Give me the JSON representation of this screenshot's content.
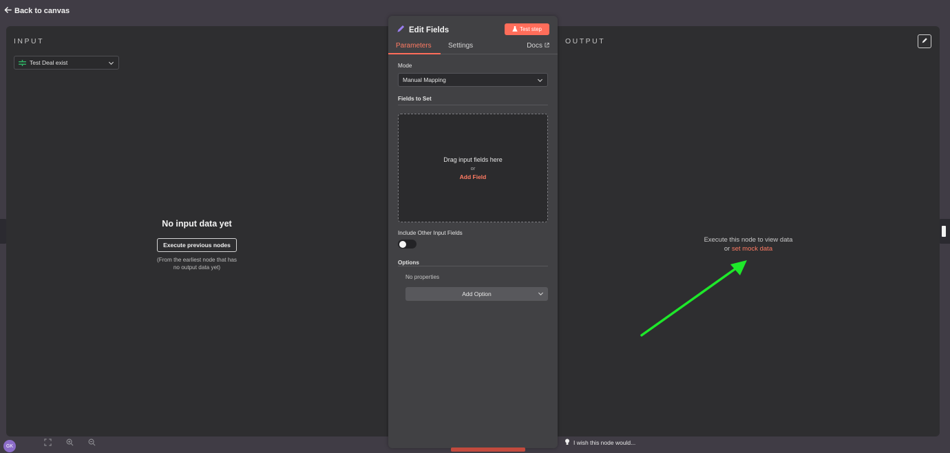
{
  "topbar": {
    "back_label": "Back to canvas"
  },
  "input_panel": {
    "title": "INPUT",
    "selected_node": "Test Deal exist",
    "empty_title": "No input data yet",
    "execute_button": "Execute previous nodes",
    "hint_line1": "(From the earliest node that has",
    "hint_line2": "no output data yet)"
  },
  "output_panel": {
    "title": "OUTPUT",
    "empty_line": "Execute this node to view data",
    "or_label": "or",
    "mock_link": "set mock data"
  },
  "node_panel": {
    "title": "Edit Fields",
    "test_step_label": "Test step",
    "tabs": [
      {
        "label": "Parameters",
        "active": true
      },
      {
        "label": "Settings",
        "active": false
      }
    ],
    "docs_label": "Docs",
    "mode_label": "Mode",
    "mode_value": "Manual Mapping",
    "fields_to_set_label": "Fields to Set",
    "dropzone_text": "Drag input fields here",
    "dropzone_or": "or",
    "add_field_label": "Add Field",
    "include_other_label": "Include Other Input Fields",
    "include_other_enabled": false,
    "options_label": "Options",
    "no_properties": "No properties",
    "add_option_label": "Add Option"
  },
  "footer": {
    "avatar_initials": "GK",
    "wish_label": "I wish this node would..."
  },
  "colors": {
    "accent": "#ff6d5a",
    "link": "#ff7b63",
    "annotation_arrow": "#1ee82a",
    "node_icon": "#2fb968",
    "edit_icon": "#9b7ff0"
  },
  "icons": {
    "back": "arrow-left-icon",
    "node": "node-type-icon",
    "edit": "pencil-icon",
    "test": "flask-icon",
    "docs": "external-link-icon",
    "zoom": [
      "fit-view-icon",
      "zoom-in-icon",
      "zoom-out-icon"
    ],
    "wish": "lightbulb-icon"
  }
}
